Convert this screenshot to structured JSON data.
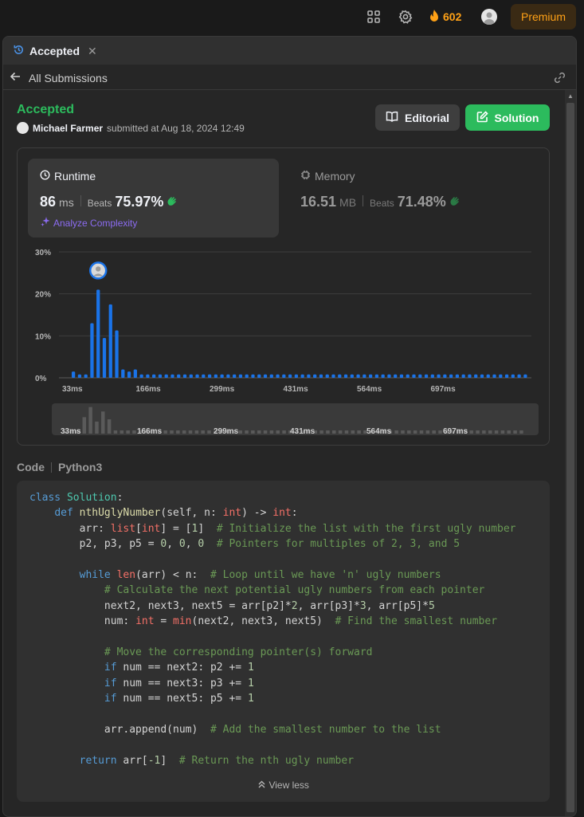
{
  "topbar": {
    "streak_count": "602",
    "premium_label": "Premium"
  },
  "tab": {
    "label": "Accepted",
    "close": "✕"
  },
  "subbar": {
    "back_label": "All Submissions"
  },
  "submission": {
    "status": "Accepted",
    "user": "Michael Farmer",
    "submitted_text": "submitted at Aug 18, 2024 12:49"
  },
  "buttons": {
    "editorial": "Editorial",
    "solution": "Solution"
  },
  "runtime": {
    "title": "Runtime",
    "value": "86",
    "unit": "ms",
    "beats_label": "Beats",
    "beats_pct": "75.97%",
    "analyze_label": "Analyze Complexity"
  },
  "memory": {
    "title": "Memory",
    "value": "16.51",
    "unit": "MB",
    "beats_label": "Beats",
    "beats_pct": "71.48%"
  },
  "chart_data": {
    "type": "bar",
    "ylabel_ticks": [
      "30%",
      "20%",
      "10%",
      "0%"
    ],
    "ylim": [
      0,
      30
    ],
    "xtick_labels": [
      "33ms",
      "166ms",
      "299ms",
      "431ms",
      "564ms",
      "697ms"
    ],
    "values": [
      1.5,
      0.8,
      0.8,
      13,
      21,
      9.5,
      17.5,
      11.3,
      2,
      1.5,
      2,
      0.8,
      0.8,
      0.8,
      0.8,
      0.8,
      0.8,
      0.8,
      0.8,
      0.8,
      0.8,
      0.8,
      0.8,
      0.8,
      0.8,
      0.8,
      0.8,
      0.8,
      0.8,
      0.8,
      0.8,
      0.8,
      0.8,
      0.8,
      0.8,
      0.8,
      0.8,
      0.8,
      0.8,
      0.8,
      0.8,
      0.8,
      0.8,
      0.8,
      0.8,
      0.8,
      0.8,
      0.8,
      0.8,
      0.8,
      0.8,
      0.8,
      0.8,
      0.8,
      0.8,
      0.8,
      0.8,
      0.8,
      0.8,
      0.8,
      0.8,
      0.8,
      0.8,
      0.8,
      0.8,
      0.8,
      0.8,
      0.8,
      0.8,
      0.8,
      0.8,
      0.8,
      0.8,
      0.8
    ],
    "highlight_index": 4,
    "bar_color": "#1a73e8",
    "grid": true
  },
  "code": {
    "label": "Code",
    "language": "Python3",
    "view_less": "View less",
    "lines": [
      "class Solution:",
      "    def nthUglyNumber(self, n: int) -> int:",
      "        arr: list[int] = [1]  # Initialize the list with the first ugly number",
      "        p2, p3, p5 = 0, 0, 0  # Pointers for multiples of 2, 3, and 5",
      "",
      "        while len(arr) < n:  # Loop until we have 'n' ugly numbers",
      "            # Calculate the next potential ugly numbers from each pointer",
      "            next2, next3, next5 = arr[p2]*2, arr[p3]*3, arr[p5]*5",
      "            num: int = min(next2, next3, next5)  # Find the smallest number",
      "",
      "            # Move the corresponding pointer(s) forward",
      "            if num == next2: p2 += 1",
      "            if num == next3: p3 += 1",
      "            if num == next5: p5 += 1",
      "",
      "            arr.append(num)  # Add the smallest number to the list",
      "",
      "        return arr[-1]  # Return the nth ugly number"
    ]
  },
  "colors": {
    "accepted": "#2cbb5d",
    "premium": "#ffa116",
    "analyze": "#8c6cf2"
  }
}
